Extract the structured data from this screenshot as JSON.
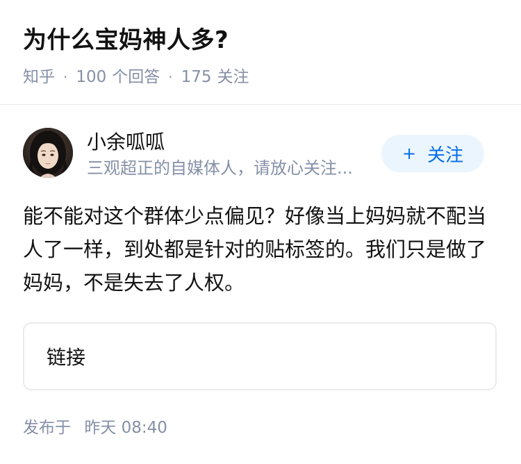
{
  "question": {
    "title": "为什么宝妈神人多?",
    "source": "知乎",
    "answer_count": "100",
    "answer_label": "个回答",
    "follower_count": "175",
    "follower_label": "关注",
    "separator": "·"
  },
  "author": {
    "name": "小余呱呱",
    "bio": "三观超正的自媒体人，请放心关注...",
    "follow_label": "关注",
    "follow_plus": "+",
    "avatar_icon": "avatar-portrait"
  },
  "answer": {
    "text": "能不能对这个群体少点偏见？好像当上妈妈就不配当人了一样，到处都是针对的贴标签的。我们只是做了妈妈，不是失去了人权。"
  },
  "link_card": {
    "label": "链接"
  },
  "publish": {
    "label": "发布于",
    "time": "昨天 08:40"
  },
  "colors": {
    "primary_text": "#121212",
    "secondary_text": "#8590a6",
    "accent_blue": "#056de8",
    "follow_bg": "#ebf5fd",
    "border": "#ebebeb"
  }
}
